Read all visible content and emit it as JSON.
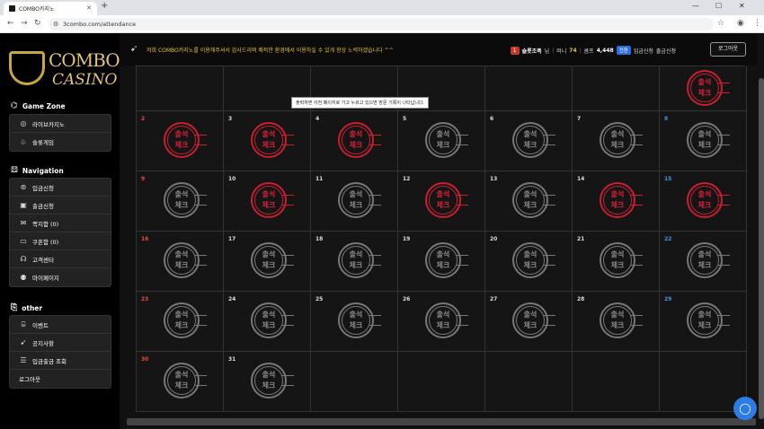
{
  "browser": {
    "tab_title": "COMBO카지노",
    "tab_close": "✕",
    "new_tab": "+",
    "url": "3combo.com/attendance"
  },
  "sidebar": {
    "logo_line1": "COMBO",
    "logo_line2": "CASINO",
    "game_zone": {
      "title": "Game Zone",
      "items": [
        {
          "label": "라이브카지노",
          "icon": "casino-chip-icon"
        },
        {
          "label": "슬롯게임",
          "icon": "slot-icon"
        }
      ]
    },
    "navigation": {
      "title": "Navigation",
      "items": [
        {
          "label": "입금신청",
          "icon": "deposit-icon"
        },
        {
          "label": "출금신청",
          "icon": "withdraw-icon"
        },
        {
          "label": "쪽지함 (0)",
          "icon": "mail-icon"
        },
        {
          "label": "쿠폰함 (0)",
          "icon": "coupon-icon"
        },
        {
          "label": "고객센터",
          "icon": "headset-icon"
        },
        {
          "label": "마이페이지",
          "icon": "user-icon"
        }
      ]
    },
    "other": {
      "title": "other",
      "items": [
        {
          "label": "이벤트",
          "icon": "gift-icon"
        },
        {
          "label": "공지사항",
          "icon": "megaphone-icon"
        },
        {
          "label": "입금출금 조회",
          "icon": "list-icon"
        },
        {
          "label": "로그아웃",
          "icon": ""
        }
      ]
    }
  },
  "topbar": {
    "notice": "저희 COMBO카지노를 이용해주셔서 감사드리며 쾌적한 환경에서 이용하실 수 있게 항상 노력하겠습니다 ^^",
    "level": "1",
    "username": "슬롯조폭",
    "honorific": "님",
    "money_label": "머니",
    "money": "74",
    "point_label": "콤프",
    "point": "4,448",
    "convert": "전환",
    "deposit": "입금신청",
    "withdraw": "출금신청",
    "logout": "로그아웃"
  },
  "calendar": {
    "tooltip": "출력하면 이전 페이지로 가고 누르고 있으면 방문 기록이 나타납니다.",
    "stamp_text_line1": "출석",
    "stamp_text_line2": "체크",
    "colors": {
      "red_stamp": "#c81e32",
      "gray_stamp": "#777777",
      "sunday": "#e74c3c",
      "saturday": "#4a90e2"
    },
    "first_row": [
      {
        "day": "",
        "stamp": ""
      },
      {
        "day": "",
        "stamp": ""
      },
      {
        "day": "",
        "stamp": ""
      },
      {
        "day": "",
        "stamp": ""
      },
      {
        "day": "",
        "stamp": ""
      },
      {
        "day": "",
        "stamp": ""
      },
      {
        "day": "",
        "stamp": "red"
      }
    ],
    "rows": [
      [
        {
          "day": "2",
          "stamp": "red"
        },
        {
          "day": "3",
          "stamp": "red"
        },
        {
          "day": "4",
          "stamp": "red"
        },
        {
          "day": "5",
          "stamp": "gray"
        },
        {
          "day": "6",
          "stamp": "gray"
        },
        {
          "day": "7",
          "stamp": "gray"
        },
        {
          "day": "8",
          "stamp": "gray"
        }
      ],
      [
        {
          "day": "9",
          "stamp": "gray"
        },
        {
          "day": "10",
          "stamp": "red"
        },
        {
          "day": "11",
          "stamp": "gray"
        },
        {
          "day": "12",
          "stamp": "red"
        },
        {
          "day": "13",
          "stamp": "gray"
        },
        {
          "day": "14",
          "stamp": "red"
        },
        {
          "day": "15",
          "stamp": "red"
        }
      ],
      [
        {
          "day": "16",
          "stamp": "gray"
        },
        {
          "day": "17",
          "stamp": "gray"
        },
        {
          "day": "18",
          "stamp": "gray"
        },
        {
          "day": "19",
          "stamp": "gray"
        },
        {
          "day": "20",
          "stamp": "gray"
        },
        {
          "day": "21",
          "stamp": "gray"
        },
        {
          "day": "22",
          "stamp": "gray"
        }
      ],
      [
        {
          "day": "23",
          "stamp": "gray"
        },
        {
          "day": "24",
          "stamp": "gray"
        },
        {
          "day": "25",
          "stamp": "gray"
        },
        {
          "day": "26",
          "stamp": "gray"
        },
        {
          "day": "27",
          "stamp": "gray"
        },
        {
          "day": "28",
          "stamp": "gray"
        },
        {
          "day": "29",
          "stamp": "gray"
        }
      ],
      [
        {
          "day": "30",
          "stamp": "gray"
        },
        {
          "day": "31",
          "stamp": "gray"
        },
        {
          "day": "",
          "stamp": ""
        },
        {
          "day": "",
          "stamp": ""
        },
        {
          "day": "",
          "stamp": ""
        },
        {
          "day": "",
          "stamp": ""
        },
        {
          "day": "",
          "stamp": ""
        }
      ]
    ]
  }
}
